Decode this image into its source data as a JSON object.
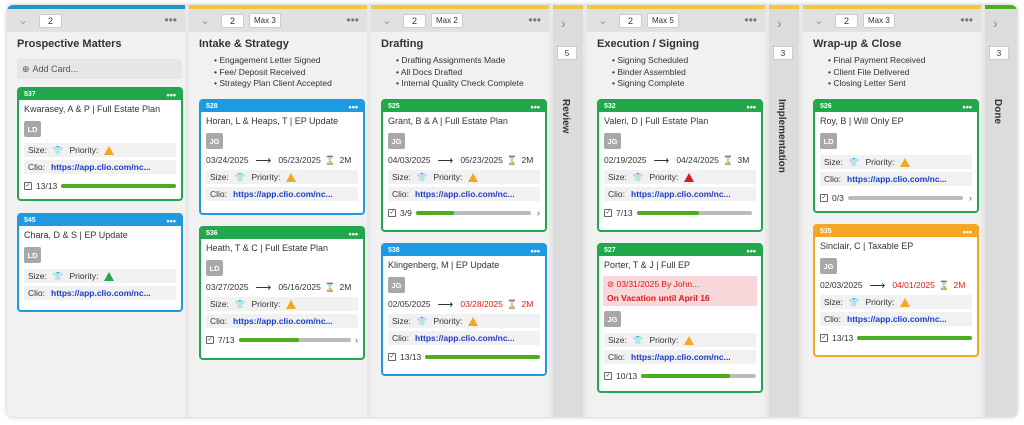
{
  "colors": {
    "green": "#22a84a",
    "blue": "#1e9be0",
    "orange": "#f5a623",
    "gold": "#f5c542",
    "teal": "#2196c8",
    "limegreen": "#4cae1f"
  },
  "columns": [
    {
      "id": "prospective",
      "count": "2",
      "title": "Prospective Matters",
      "add_card": "Add Card...",
      "cards": [
        {
          "num": "537",
          "name": "Kwarasey, A & P | Full Estate Plan",
          "avatar": "LD",
          "size": "Size:",
          "priority": "Priority:",
          "priority_level": "warning",
          "clio_label": "Clio:",
          "clio_link": "https://app.clio.com/nc...",
          "checklist": "13/13",
          "progress": 1.0
        },
        {
          "num": "545",
          "name": "Chara, D & S | EP Update",
          "avatar": "LD",
          "size": "Size:",
          "priority": "Priority:",
          "priority_level": "low",
          "clio_label": "Clio:",
          "clio_link": "https://app.clio.com/nc..."
        }
      ]
    },
    {
      "id": "intake",
      "count": "2",
      "max": "Max 3",
      "title": "Intake & Strategy",
      "bullets": [
        "Engagement Letter Signed",
        "Fee/ Deposit Received",
        "Strategy Plan Client Accepted"
      ],
      "cards": [
        {
          "num": "528",
          "name": "Horan, L & Heaps, T | EP Update",
          "avatar": "JG",
          "start": "03/24/2025",
          "end": "05/23/2025",
          "duration": "2M",
          "size": "Size:",
          "priority": "Priority:",
          "priority_level": "warning",
          "clio_label": "Clio:",
          "clio_link": "https://app.clio.com/nc..."
        },
        {
          "num": "536",
          "name": "Heath, T & C | Full Estate Plan",
          "avatar": "LD",
          "start": "03/27/2025",
          "end": "05/16/2025",
          "duration": "2M",
          "size": "Size:",
          "priority": "Priority:",
          "priority_level": "warning",
          "clio_label": "Clio:",
          "clio_link": "https://app.clio.com/nc...",
          "checklist": "7/13",
          "progress": 0.54
        }
      ]
    },
    {
      "id": "drafting",
      "count": "2",
      "max": "Max 2",
      "title": "Drafting",
      "bullets": [
        "Drafting Assignments Made",
        "All Docs Drafted",
        "Internal Quality Check Complete"
      ],
      "cards": [
        {
          "num": "525",
          "name": "Grant, B & A | Full Estate Plan",
          "avatar": "JG",
          "start": "04/03/2025",
          "end": "05/23/2025",
          "duration": "2M",
          "size": "Size:",
          "priority": "Priority:",
          "priority_level": "warning",
          "clio_label": "Clio:",
          "clio_link": "https://app.clio.com/nc...",
          "checklist": "3/9",
          "progress": 0.33
        },
        {
          "num": "538",
          "name": "Klingenberg, M | EP Update",
          "avatar": "JG",
          "start": "02/05/2025",
          "end": "03/28/2025",
          "duration": "2M",
          "size": "Size:",
          "priority": "Priority:",
          "priority_level": "warning",
          "clio_label": "Clio:",
          "clio_link": "https://app.clio.com/nc...",
          "checklist": "13/13",
          "progress": 1.0
        }
      ]
    },
    {
      "id": "review",
      "count": "5",
      "label": "Review"
    },
    {
      "id": "execution",
      "count": "2",
      "max": "Max 5",
      "title": "Execution / Signing",
      "bullets": [
        "Signing Scheduled",
        "Binder Assembled",
        "Signing Complete"
      ],
      "cards": [
        {
          "num": "532",
          "name": "Valeri, D | Full Estate Plan",
          "avatar": "JG",
          "start": "02/19/2025",
          "end": "04/24/2025",
          "duration": "3M",
          "size": "Size:",
          "priority": "Priority:",
          "priority_level": "high",
          "clio_label": "Clio:",
          "clio_link": "https://app.clio.com/nc...",
          "checklist": "7/13",
          "progress": 0.54
        },
        {
          "num": "527",
          "name": "Porter, T & J | Full EP",
          "warning_line": "03/31/2025 By John...",
          "warning_note": "On Vacation until April 16",
          "avatar": "JG",
          "size": "Size:",
          "priority": "Priority:",
          "priority_level": "warning",
          "clio_label": "Clio:",
          "clio_link": "https://app.clio.com/nc...",
          "checklist": "10/13",
          "progress": 0.77
        }
      ]
    },
    {
      "id": "implementation",
      "count": "3",
      "label": "Implementation"
    },
    {
      "id": "wrapup",
      "count": "2",
      "max": "Max 3",
      "title": "Wrap-up & Close",
      "bullets": [
        "Final Payment Received",
        "Client File Delivered",
        "Closing Letter Sent"
      ],
      "cards": [
        {
          "num": "526",
          "name": "Roy, B | Will Only EP",
          "avatar": "LD",
          "size": "Size:",
          "priority": "Priority:",
          "priority_level": "warning",
          "clio_label": "Clio:",
          "clio_link": "https://app.clio.com/nc...",
          "checklist": "0/3",
          "progress": 0
        },
        {
          "num": "535",
          "name": "Sinclair, C | Taxable EP",
          "avatar": "JG",
          "start": "02/03/2025",
          "end": "04/01/2025",
          "duration": "2M",
          "size": "Size:",
          "priority": "Priority:",
          "priority_level": "warning",
          "clio_label": "Clio:",
          "clio_link": "https://app.clio.com/nc...",
          "checklist": "13/13",
          "progress": 1.0
        }
      ]
    },
    {
      "id": "done",
      "count": "3",
      "label": "Done"
    }
  ]
}
